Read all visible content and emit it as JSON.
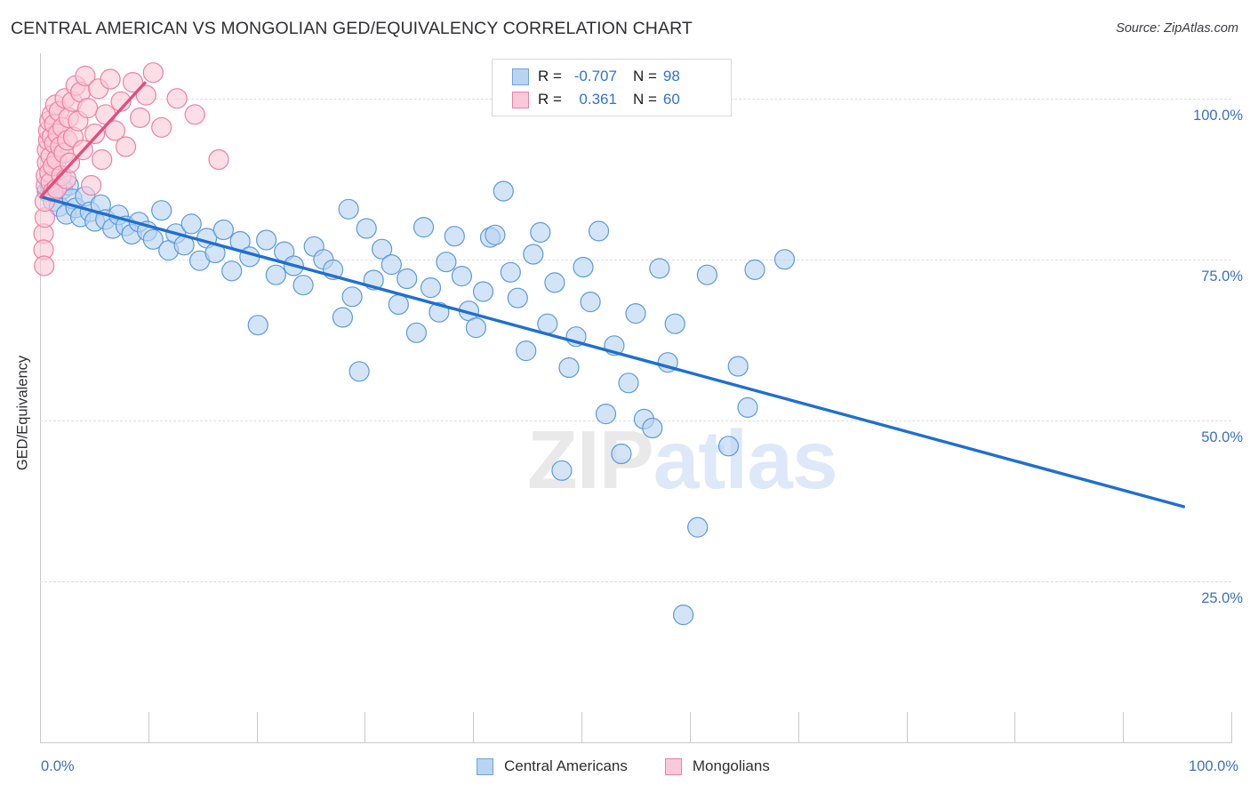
{
  "header": {
    "title": "CENTRAL AMERICAN VS MONGOLIAN GED/EQUIVALENCY CORRELATION CHART",
    "source": "Source: ZipAtlas.com"
  },
  "watermark": {
    "part1": "ZIP",
    "part2": "atlas"
  },
  "stats_legend": {
    "rows": [
      {
        "series": "Central Americans",
        "color": "#b9d4f2",
        "r_label": "R =",
        "r_value": "-0.707",
        "n_label": "N =",
        "n_value": "98"
      },
      {
        "series": "Mongolians",
        "color": "#fac9d9",
        "r_label": "R =",
        "r_value": "0.361",
        "n_label": "N =",
        "n_value": "60"
      }
    ]
  },
  "series_legend": [
    {
      "label": "Central Americans",
      "color": "#b9d4f2",
      "border": "#6ea3e0"
    },
    {
      "label": "Mongolians",
      "color": "#fac9d9",
      "border": "#ef7fa4"
    }
  ],
  "chart_data": {
    "type": "scatter",
    "title": "CENTRAL AMERICAN VS MONGOLIAN GED/EQUIVALENCY CORRELATION CHART",
    "xlabel": "",
    "ylabel": "GED/Equivalency",
    "xlim": [
      0,
      100
    ],
    "ylim": [
      0,
      107
    ],
    "grid": true,
    "x_tick_labels": [
      "0.0%",
      "100.0%"
    ],
    "y_tick_labels": [
      "100.0%",
      "75.0%",
      "50.0%",
      "25.0%"
    ],
    "y_ticks": [
      100,
      75,
      50,
      25
    ],
    "legend_position": "bottom-center",
    "series": [
      {
        "name": "Central Americans",
        "color": "#b9d4f2",
        "stroke": "#5b9bd9",
        "r": -0.707,
        "n": 98,
        "trendline": {
          "x0": 0.1,
          "y0": 84.7,
          "x1": 96.0,
          "y1": 36.6,
          "color": "#1f6fd0"
        },
        "points": [
          [
            0.6,
            85.5
          ],
          [
            0.9,
            86.2
          ],
          [
            1.1,
            84.0
          ],
          [
            1.3,
            87.0
          ],
          [
            1.6,
            83.2
          ],
          [
            1.9,
            85.9
          ],
          [
            2.2,
            82.0
          ],
          [
            2.4,
            86.5
          ],
          [
            2.7,
            84.4
          ],
          [
            3.0,
            83.0
          ],
          [
            3.4,
            81.6
          ],
          [
            3.8,
            84.8
          ],
          [
            4.2,
            82.4
          ],
          [
            4.6,
            80.9
          ],
          [
            5.1,
            83.5
          ],
          [
            5.5,
            81.2
          ],
          [
            6.1,
            79.8
          ],
          [
            6.6,
            81.9
          ],
          [
            7.2,
            80.2
          ],
          [
            7.7,
            78.9
          ],
          [
            8.3,
            80.8
          ],
          [
            9.0,
            79.4
          ],
          [
            9.5,
            78.1
          ],
          [
            10.2,
            82.6
          ],
          [
            10.8,
            76.4
          ],
          [
            11.4,
            79.0
          ],
          [
            12.1,
            77.2
          ],
          [
            12.7,
            80.5
          ],
          [
            13.4,
            74.8
          ],
          [
            14.0,
            78.3
          ],
          [
            14.7,
            76.0
          ],
          [
            15.4,
            79.6
          ],
          [
            16.1,
            73.2
          ],
          [
            16.8,
            77.8
          ],
          [
            17.6,
            75.4
          ],
          [
            18.3,
            64.8
          ],
          [
            19.0,
            78.0
          ],
          [
            19.8,
            72.6
          ],
          [
            20.5,
            76.2
          ],
          [
            21.3,
            74.0
          ],
          [
            22.1,
            71.0
          ],
          [
            23.0,
            77.0
          ],
          [
            23.8,
            75.0
          ],
          [
            24.6,
            73.4
          ],
          [
            25.4,
            66.0
          ],
          [
            25.9,
            82.8
          ],
          [
            26.2,
            69.2
          ],
          [
            26.8,
            57.6
          ],
          [
            27.4,
            79.8
          ],
          [
            28.0,
            71.8
          ],
          [
            28.7,
            76.6
          ],
          [
            29.5,
            74.2
          ],
          [
            30.1,
            68.0
          ],
          [
            30.8,
            72.0
          ],
          [
            31.6,
            63.6
          ],
          [
            32.2,
            80.0
          ],
          [
            32.8,
            70.6
          ],
          [
            33.5,
            66.8
          ],
          [
            34.1,
            74.6
          ],
          [
            34.8,
            78.6
          ],
          [
            35.4,
            72.4
          ],
          [
            36.0,
            67.0
          ],
          [
            36.6,
            64.4
          ],
          [
            37.2,
            70.0
          ],
          [
            37.8,
            78.4
          ],
          [
            38.2,
            78.8
          ],
          [
            38.9,
            85.6
          ],
          [
            39.5,
            73.0
          ],
          [
            40.1,
            69.0
          ],
          [
            40.8,
            60.8
          ],
          [
            41.4,
            75.8
          ],
          [
            42.0,
            79.2
          ],
          [
            42.6,
            65.0
          ],
          [
            43.2,
            71.4
          ],
          [
            43.8,
            42.2
          ],
          [
            44.4,
            58.2
          ],
          [
            45.0,
            63.0
          ],
          [
            45.6,
            73.8
          ],
          [
            46.2,
            68.4
          ],
          [
            46.9,
            79.4
          ],
          [
            47.5,
            51.0
          ],
          [
            48.2,
            61.6
          ],
          [
            48.8,
            44.8
          ],
          [
            49.4,
            55.8
          ],
          [
            50.0,
            66.6
          ],
          [
            50.7,
            50.2
          ],
          [
            51.4,
            48.8
          ],
          [
            52.0,
            73.6
          ],
          [
            52.7,
            59.0
          ],
          [
            53.3,
            65.0
          ],
          [
            54.0,
            19.8
          ],
          [
            55.2,
            33.4
          ],
          [
            56.0,
            72.6
          ],
          [
            57.8,
            46.0
          ],
          [
            58.6,
            58.4
          ],
          [
            59.4,
            52.0
          ],
          [
            60.0,
            73.4
          ],
          [
            62.5,
            75.0
          ]
        ]
      },
      {
        "name": "Mongolians",
        "color": "#fac9d9",
        "stroke": "#f07fa3",
        "r": 0.361,
        "n": 60,
        "trendline": {
          "x0": 0.1,
          "y0": 84.8,
          "x1": 8.8,
          "y1": 102.4,
          "color": "#e04f7d"
        },
        "points": [
          [
            0.3,
            79.0
          ],
          [
            0.4,
            81.5
          ],
          [
            0.4,
            84.0
          ],
          [
            0.5,
            86.5
          ],
          [
            0.5,
            88.0
          ],
          [
            0.6,
            90.0
          ],
          [
            0.6,
            92.0
          ],
          [
            0.7,
            93.5
          ],
          [
            0.7,
            95.0
          ],
          [
            0.8,
            96.5
          ],
          [
            0.8,
            88.5
          ],
          [
            0.9,
            87.0
          ],
          [
            0.9,
            91.0
          ],
          [
            1.0,
            94.0
          ],
          [
            1.0,
            97.5
          ],
          [
            1.1,
            85.5
          ],
          [
            1.1,
            89.5
          ],
          [
            1.2,
            93.0
          ],
          [
            1.2,
            96.0
          ],
          [
            1.3,
            99.0
          ],
          [
            1.4,
            86.0
          ],
          [
            1.4,
            90.5
          ],
          [
            1.5,
            94.5
          ],
          [
            1.6,
            98.0
          ],
          [
            1.7,
            92.5
          ],
          [
            1.8,
            88.0
          ],
          [
            1.9,
            95.5
          ],
          [
            2.0,
            91.5
          ],
          [
            2.1,
            100.0
          ],
          [
            2.2,
            87.5
          ],
          [
            2.3,
            93.5
          ],
          [
            2.4,
            97.0
          ],
          [
            2.5,
            90.0
          ],
          [
            2.7,
            99.5
          ],
          [
            2.8,
            94.0
          ],
          [
            3.0,
            102.0
          ],
          [
            3.2,
            96.5
          ],
          [
            3.4,
            101.0
          ],
          [
            3.6,
            92.0
          ],
          [
            3.8,
            103.5
          ],
          [
            4.0,
            98.5
          ],
          [
            4.3,
            86.5
          ],
          [
            4.6,
            94.5
          ],
          [
            4.9,
            101.5
          ],
          [
            5.2,
            90.5
          ],
          [
            5.5,
            97.5
          ],
          [
            5.9,
            103.0
          ],
          [
            6.3,
            95.0
          ],
          [
            6.8,
            99.5
          ],
          [
            7.2,
            92.5
          ],
          [
            7.8,
            102.5
          ],
          [
            8.4,
            97.0
          ],
          [
            8.9,
            100.5
          ],
          [
            9.5,
            104.0
          ],
          [
            10.2,
            95.5
          ],
          [
            11.5,
            100.0
          ],
          [
            13.0,
            97.5
          ],
          [
            15.0,
            90.5
          ],
          [
            0.3,
            76.5
          ],
          [
            0.35,
            74.0
          ]
        ]
      }
    ]
  }
}
